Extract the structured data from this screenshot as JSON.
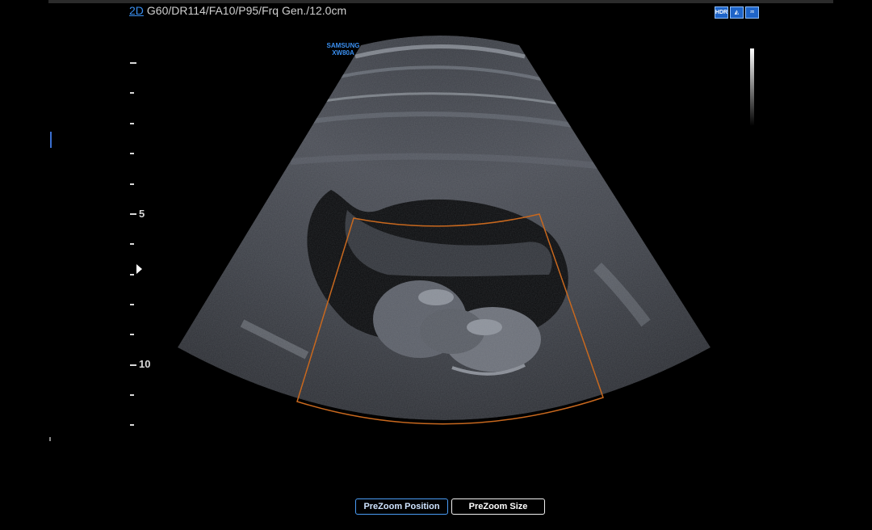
{
  "header": {
    "mode": "2D",
    "params": "G60/DR114/FA10/P95/Frq Gen./12.0cm"
  },
  "status_icons": [
    {
      "name": "hdr-icon",
      "label": "HDR"
    },
    {
      "name": "probe-icon",
      "label": "◭"
    },
    {
      "name": "fetus-icon",
      "label": "♒"
    }
  ],
  "brand": {
    "line1": "SAMSUNG",
    "line2": "XW80A"
  },
  "depth_scale": {
    "unit": "cm",
    "max": 12,
    "labels": [
      "5",
      "10"
    ]
  },
  "buttons": {
    "prezoom_position": "PreZoom Position",
    "prezoom_size": "PreZoom Size"
  },
  "colors": {
    "accent": "#3a8ff0",
    "roi_box": "#c8681e",
    "button_active_border": "#4a9cf5"
  }
}
